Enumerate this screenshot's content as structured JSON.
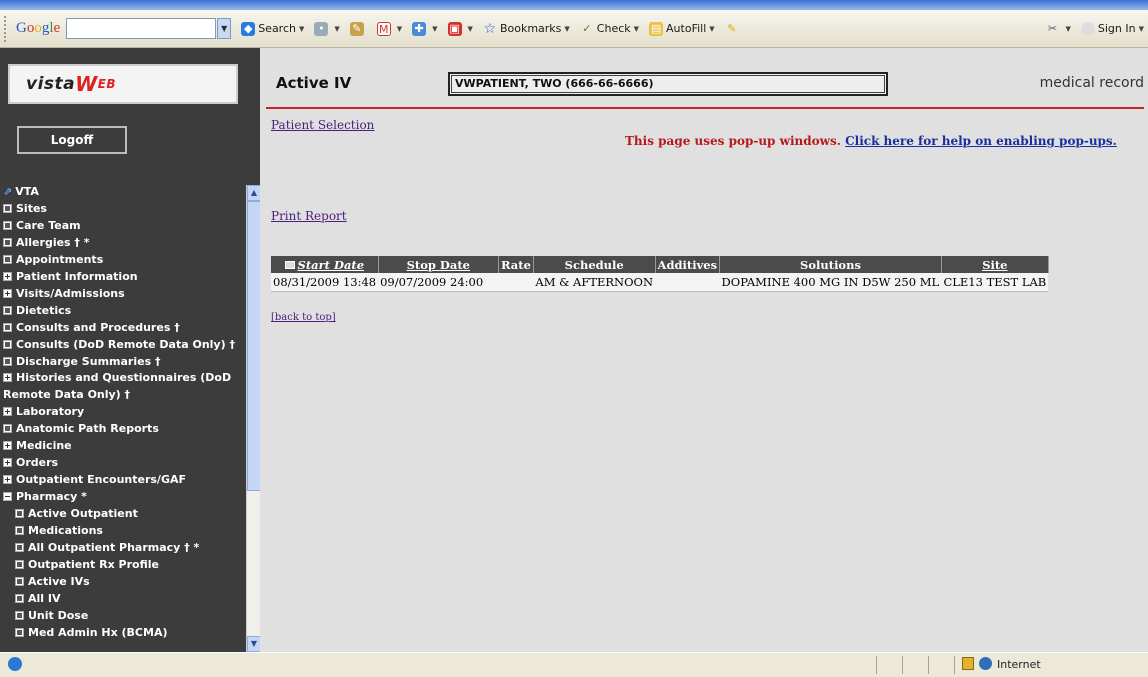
{
  "toolbar": {
    "google_logo": "Google",
    "search": "Search",
    "bookmarks": "Bookmarks",
    "check": "Check",
    "autofill": "AutoFill",
    "sign_in": "Sign In"
  },
  "sidebar": {
    "logoff": "Logoff",
    "items": [
      {
        "label": "VTA",
        "box": "vta",
        "sub": false
      },
      {
        "label": "Sites",
        "box": "dot",
        "sub": false
      },
      {
        "label": "Care Team",
        "box": "dot",
        "sub": false
      },
      {
        "label": "Allergies † *",
        "box": "dot",
        "sub": false
      },
      {
        "label": "Appointments",
        "box": "dot",
        "sub": false
      },
      {
        "label": "Patient Information",
        "box": "plus",
        "sub": false
      },
      {
        "label": "Visits/Admissions",
        "box": "plus",
        "sub": false
      },
      {
        "label": "Dietetics",
        "box": "dot",
        "sub": false
      },
      {
        "label": "Consults and Procedures †",
        "box": "dot",
        "sub": false
      },
      {
        "label": "Consults (DoD Remote Data Only) †",
        "box": "dot",
        "sub": false
      },
      {
        "label": "Discharge Summaries †",
        "box": "dot",
        "sub": false
      },
      {
        "label": "Histories and Questionnaires (DoD Remote Data Only) †",
        "box": "plus",
        "sub": false
      },
      {
        "label": "Laboratory",
        "box": "plus",
        "sub": false
      },
      {
        "label": "Anatomic Path Reports",
        "box": "dot",
        "sub": false
      },
      {
        "label": "Medicine",
        "box": "plus",
        "sub": false
      },
      {
        "label": "Orders",
        "box": "plus",
        "sub": false
      },
      {
        "label": "Outpatient Encounters/GAF",
        "box": "plus",
        "sub": false
      },
      {
        "label": "Pharmacy *",
        "box": "minus",
        "sub": false
      },
      {
        "label": "Active Outpatient",
        "box": "dot",
        "sub": true
      },
      {
        "label": "Medications",
        "box": "dot",
        "sub": true
      },
      {
        "label": "All Outpatient Pharmacy † *",
        "box": "dot",
        "sub": true
      },
      {
        "label": "Outpatient Rx Profile",
        "box": "dot",
        "sub": true
      },
      {
        "label": "Active IVs",
        "box": "dot",
        "sub": true
      },
      {
        "label": "All IV",
        "box": "dot",
        "sub": true
      },
      {
        "label": "Unit Dose",
        "box": "dot",
        "sub": true
      },
      {
        "label": "Med Admin Hx (BCMA)",
        "box": "dot",
        "sub": true
      }
    ]
  },
  "main": {
    "title": "Active IV",
    "patient": "VWPATIENT, TWO (666-66-6666)",
    "medical_record": "medical record",
    "patient_selection": "Patient Selection",
    "popup_notice": "This page uses pop-up windows.",
    "popup_help_link": "Click here for help on enabling pop-ups.",
    "print_report": "Print Report",
    "back_to_top": "[back to top]",
    "table": {
      "headers": [
        "Start Date",
        "Stop Date",
        "Rate",
        "Schedule",
        "Additives",
        "Solutions",
        "Site"
      ],
      "rows": [
        [
          "08/31/2009 13:48",
          "09/07/2009 24:00",
          "",
          "AM & AFTERNOON",
          "",
          "DOPAMINE 400 MG IN D5W 250 ML",
          "CLE13 TEST LAB"
        ]
      ]
    }
  },
  "status": {
    "zone": "Internet"
  }
}
